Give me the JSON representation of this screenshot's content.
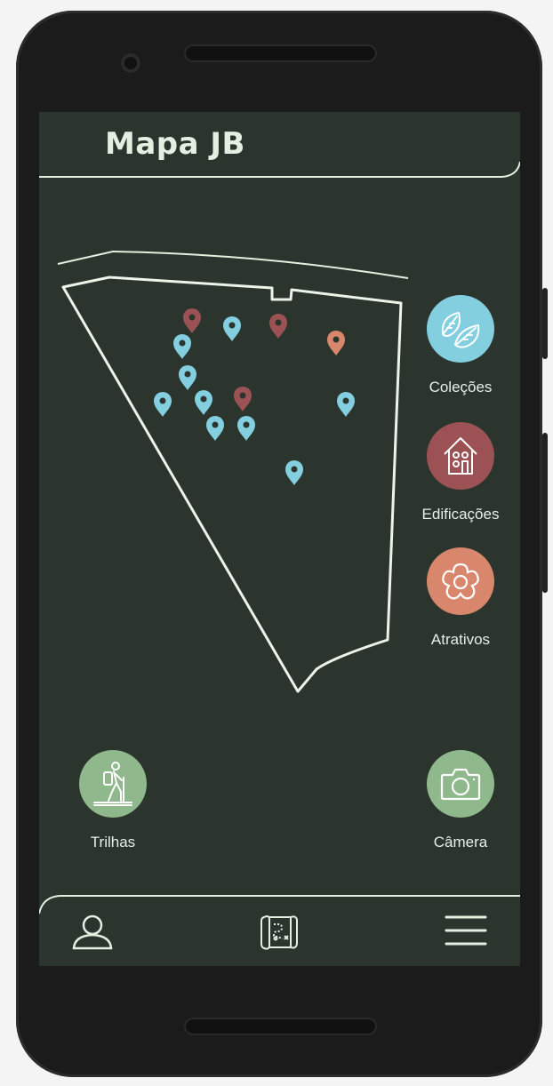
{
  "app": {
    "title": "Mapa JB"
  },
  "colors": {
    "background": "#2b352e",
    "text": "#e4efe2",
    "blue": "#83cfe0",
    "red": "#9c5254",
    "orange": "#d9876c",
    "green": "#8fb98c"
  },
  "map": {
    "pins": [
      {
        "category": "edificacoes"
      },
      {
        "category": "colecoes"
      },
      {
        "category": "edificacoes"
      },
      {
        "category": "atrativos"
      },
      {
        "category": "colecoes"
      },
      {
        "category": "colecoes"
      },
      {
        "category": "colecoes"
      },
      {
        "category": "edificacoes"
      },
      {
        "category": "colecoes"
      },
      {
        "category": "colecoes"
      },
      {
        "category": "colecoes"
      },
      {
        "category": "colecoes"
      },
      {
        "category": "colecoes"
      }
    ]
  },
  "categories": [
    {
      "id": "colecoes",
      "label": "Coleções",
      "icon": "leaves-icon",
      "color": "#83cfe0"
    },
    {
      "id": "edificacoes",
      "label": "Edificações",
      "icon": "house-icon",
      "color": "#9c5254"
    },
    {
      "id": "atrativos",
      "label": "Atrativos",
      "icon": "flower-icon",
      "color": "#d9876c"
    }
  ],
  "actions": {
    "trilhas": {
      "label": "Trilhas",
      "icon": "hiker-icon"
    },
    "camera": {
      "label": "Câmera",
      "icon": "camera-icon"
    }
  },
  "nav": {
    "profile_icon": "user-icon",
    "map_icon": "treasure-map-icon",
    "menu_icon": "hamburger-menu-icon"
  }
}
